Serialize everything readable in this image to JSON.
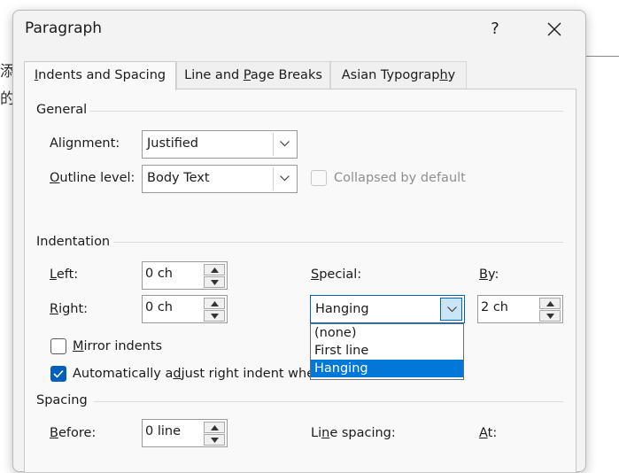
{
  "background": {
    "glyph_1": "添加",
    "glyph_2": "的结"
  },
  "dialog": {
    "title": "Paragraph",
    "help_label": "?"
  },
  "tabs": [
    {
      "label": "Indents and Spacing",
      "underline": "I",
      "rest": "ndents and Spacing",
      "active": true
    },
    {
      "label": "Line and Page Breaks",
      "pre": "Line and ",
      "underline": "P",
      "rest": "age Breaks",
      "active": false
    },
    {
      "label": "Asian Typography",
      "pre": "Asian Typograp",
      "underline": "h",
      "rest": "y",
      "active": false
    }
  ],
  "general": {
    "title": "General",
    "alignment_label": "Alignment:",
    "alignment_value": "Justified",
    "outline_pre": "",
    "outline_underline": "O",
    "outline_rest": "utline level:",
    "outline_value": "Body Text",
    "collapsed_label": "Collapsed by default",
    "collapsed_checked": false
  },
  "indentation": {
    "title": "Indentation",
    "left_underline": "L",
    "left_rest": "eft:",
    "left_value": "0 ch",
    "right_underline": "R",
    "right_rest": "ight:",
    "right_value": "0 ch",
    "special_underline": "S",
    "special_rest": "pecial:",
    "special_value": "Hanging",
    "by_underline": "B",
    "by_rest": "y:",
    "by_value": "2 ch",
    "special_options": [
      "(none)",
      "First line",
      "Hanging"
    ],
    "special_selected_index": 2,
    "mirror_underline": "M",
    "mirror_rest": "irror indents",
    "mirror_checked": false,
    "auto_pre": "Automatically a",
    "auto_underline": "d",
    "auto_rest": "just right indent when",
    "auto_checked": true
  },
  "spacing": {
    "title": "Spacing",
    "before_underline": "B",
    "before_rest": "efore:",
    "before_value": "0 line",
    "line_spacing_pre": "Li",
    "line_spacing_underline": "n",
    "line_spacing_rest": "e spacing:",
    "at_underline": "A",
    "at_rest": "t:"
  },
  "colors": {
    "accent": "#005fb8",
    "selection": "#0078d7",
    "dialog_bg": "#f3f3f3"
  }
}
